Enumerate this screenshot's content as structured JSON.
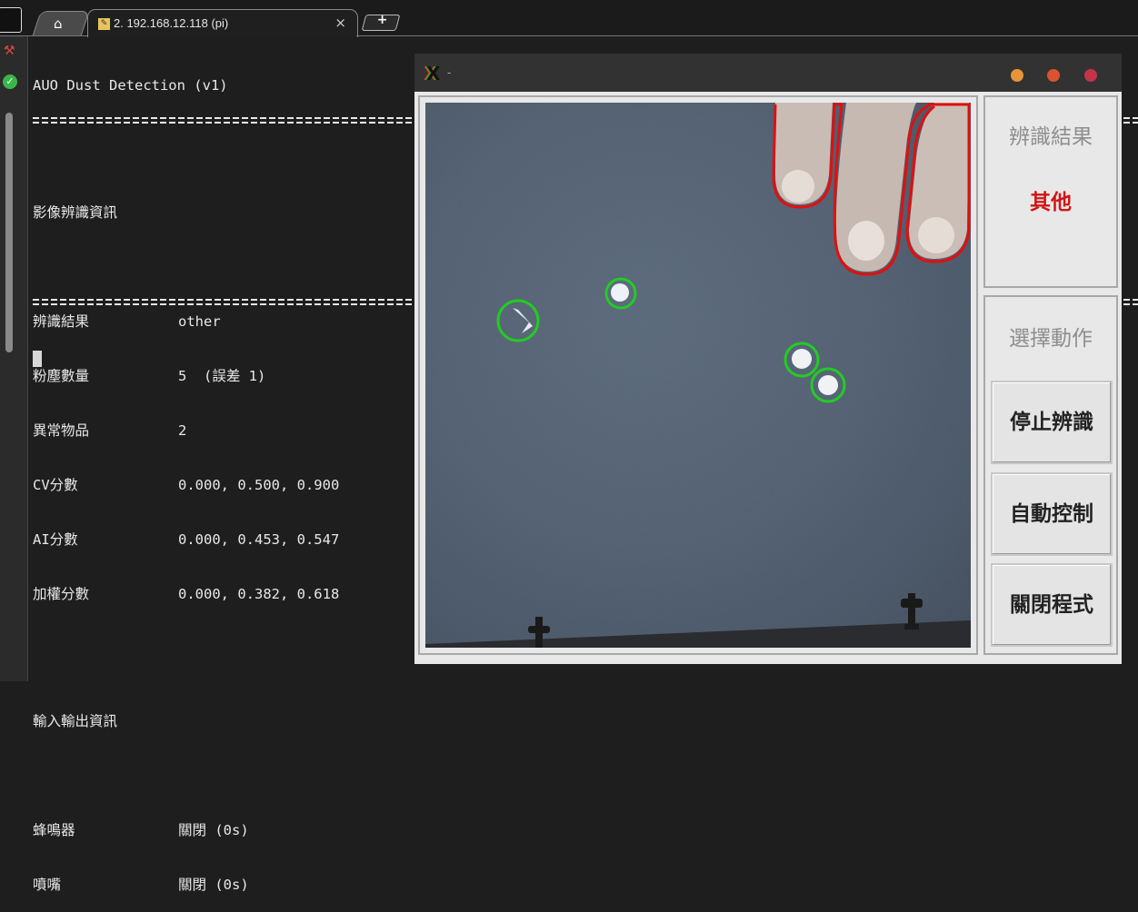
{
  "tabs": {
    "home_icon": "home-icon",
    "active_label": "2. 192.168.12.118 (pi)",
    "close_glyph": "×",
    "new_tab_glyph": "+"
  },
  "terminal": {
    "title": "AUO Dust Detection (v1)",
    "section1_title": "影像辨識資訊",
    "rows1": [
      {
        "key": "辨識結果",
        "value": "other"
      },
      {
        "key": "粉塵數量",
        "value": "5  (誤差 1)"
      },
      {
        "key": "異常物品",
        "value": "2"
      },
      {
        "key": "CV分數",
        "value": "0.000, 0.500, 0.900"
      },
      {
        "key": "AI分數",
        "value": "0.000, 0.453, 0.547"
      },
      {
        "key": "加權分數",
        "value": "0.000, 0.382, 0.618"
      }
    ],
    "section2_title": "輸入輸出資訊",
    "rows2": [
      {
        "key": "蜂鳴器",
        "value": "關閉 (0s)"
      },
      {
        "key": "噴嘴",
        "value": "關閉 (0s)"
      }
    ]
  },
  "app": {
    "title": "-",
    "result_label": "辨識結果",
    "result_value": "其他",
    "action_label": "選擇動作",
    "buttons": {
      "stop": "停止辨識",
      "auto": "自動控制",
      "close": "關閉程式"
    },
    "colors": {
      "result": "#d31515",
      "dust_ring": "#22cc22",
      "anomaly_contour": "#e01010"
    }
  }
}
